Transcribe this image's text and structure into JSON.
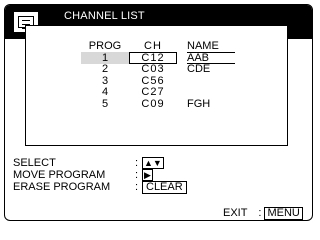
{
  "title": "CHANNEL LIST",
  "icon": "menu-list-icon",
  "table": {
    "headers": {
      "prog": "PROG",
      "ch": "CH",
      "name": "NAME"
    },
    "rows": [
      {
        "prog": "1",
        "ch": "C12",
        "name": "AAB",
        "selected": true
      },
      {
        "prog": "2",
        "ch": "C03",
        "name": "CDE"
      },
      {
        "prog": "3",
        "ch": "C56",
        "name": ""
      },
      {
        "prog": "4",
        "ch": "C27",
        "name": ""
      },
      {
        "prog": "5",
        "ch": "C09",
        "name": "FGH"
      }
    ]
  },
  "legend": {
    "select_label": "SELECT",
    "select_keys": "▲▼",
    "move_label": "MOVE PROGRAM",
    "move_keys": "▶",
    "erase_label": "ERASE PROGRAM",
    "erase_key": "CLEAR",
    "colon": ":"
  },
  "exit": {
    "label": "EXIT",
    "colon": ":",
    "key": "MENU"
  }
}
